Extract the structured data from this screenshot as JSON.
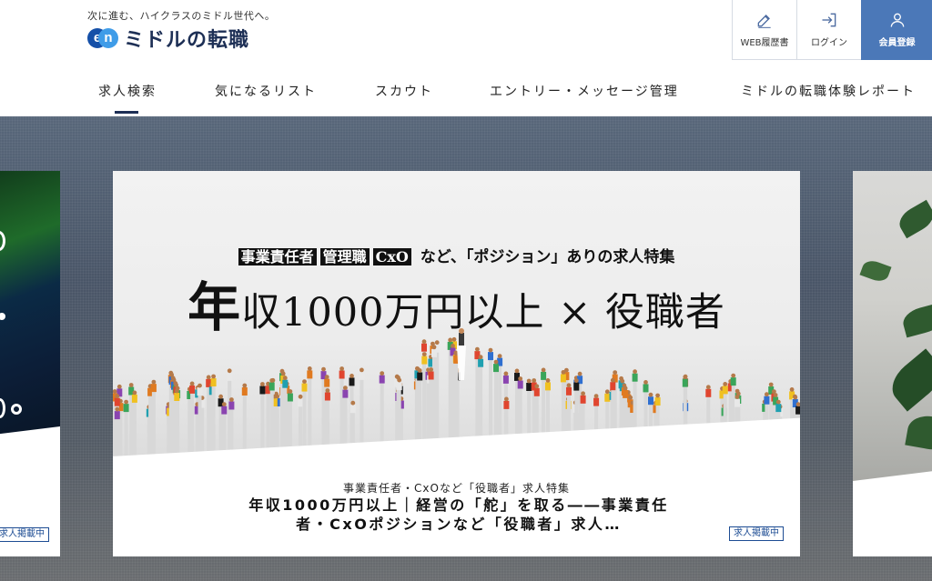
{
  "header": {
    "tagline": "次に進む、ハイクラスのミドル世代へ。",
    "logo_en": "en",
    "logo_text": "ミドルの転職",
    "buttons": [
      {
        "label": "WEB履歴書",
        "icon": "edit-icon"
      },
      {
        "label": "ログイン",
        "icon": "login-icon"
      },
      {
        "label": "会員登録",
        "icon": "user-icon"
      }
    ]
  },
  "nav": {
    "items": [
      {
        "label": "求人検索",
        "active": true
      },
      {
        "label": "気になるリスト"
      },
      {
        "label": "スカウト"
      },
      {
        "label": "エントリー・メッセージ管理"
      },
      {
        "label": "ミドルの転職体験レポート"
      }
    ]
  },
  "carousel": {
    "main": {
      "hero_tags": [
        "事業責任者",
        "管理職",
        "CxO"
      ],
      "hero_sub_suffix": "など、「ポジション」ありの求人特集",
      "hero_big": "年",
      "hero_main": "収1000万円以上 × 役職者",
      "caption_sub": "事業責任者・CxOなど「役職者」求人特集",
      "caption_title": "年収1000万円以上｜経営の「舵」を取る――事業責任者・CxOポジションなど「役職者」求人…",
      "badge": "求人掲載中"
    },
    "left": {
      "badge": "求人掲載中"
    }
  },
  "colors": {
    "brand_navy": "#1d2f55",
    "primary_button": "#4b78b8",
    "badge_blue": "#1d4c93"
  }
}
